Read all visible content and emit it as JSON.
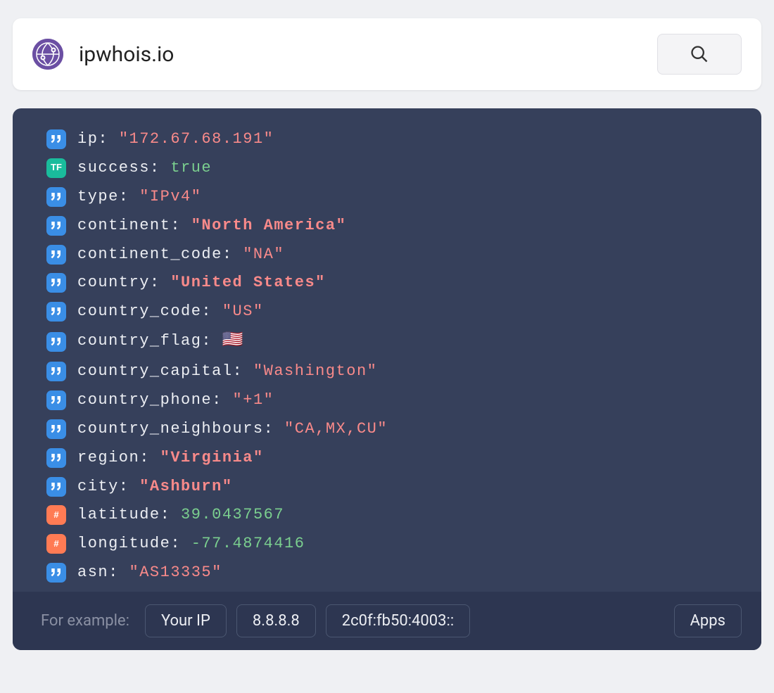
{
  "header": {
    "site_name": "ipwhois.io"
  },
  "result": {
    "rows": [
      {
        "type": "string",
        "key": "ip",
        "value": "\"172.67.68.191\"",
        "bold": false
      },
      {
        "type": "bool",
        "key": "success",
        "value": "true",
        "bold": false
      },
      {
        "type": "string",
        "key": "type",
        "value": "\"IPv4\"",
        "bold": false
      },
      {
        "type": "string",
        "key": "continent",
        "value": "\"North America\"",
        "bold": true
      },
      {
        "type": "string",
        "key": "continent_code",
        "value": "\"NA\"",
        "bold": false
      },
      {
        "type": "string",
        "key": "country",
        "value": "\"United States\"",
        "bold": true
      },
      {
        "type": "string",
        "key": "country_code",
        "value": "\"US\"",
        "bold": false
      },
      {
        "type": "flag",
        "key": "country_flag",
        "value": "🇺🇸",
        "bold": false
      },
      {
        "type": "string",
        "key": "country_capital",
        "value": "\"Washington\"",
        "bold": false
      },
      {
        "type": "string",
        "key": "country_phone",
        "value": "\"+1\"",
        "bold": false
      },
      {
        "type": "string",
        "key": "country_neighbours",
        "value": "\"CA,MX,CU\"",
        "bold": false
      },
      {
        "type": "string",
        "key": "region",
        "value": "\"Virginia\"",
        "bold": true
      },
      {
        "type": "string",
        "key": "city",
        "value": "\"Ashburn\"",
        "bold": true
      },
      {
        "type": "number",
        "key": "latitude",
        "value": "39.0437567",
        "bold": false
      },
      {
        "type": "number",
        "key": "longitude",
        "value": "-77.4874416",
        "bold": false
      },
      {
        "type": "string",
        "key": "asn",
        "value": "\"AS13335\"",
        "bold": false
      }
    ]
  },
  "footer": {
    "label": "For example:",
    "buttons": [
      "Your IP",
      "8.8.8.8",
      "2c0f:fb50:4003::"
    ],
    "apps_label": "Apps"
  }
}
